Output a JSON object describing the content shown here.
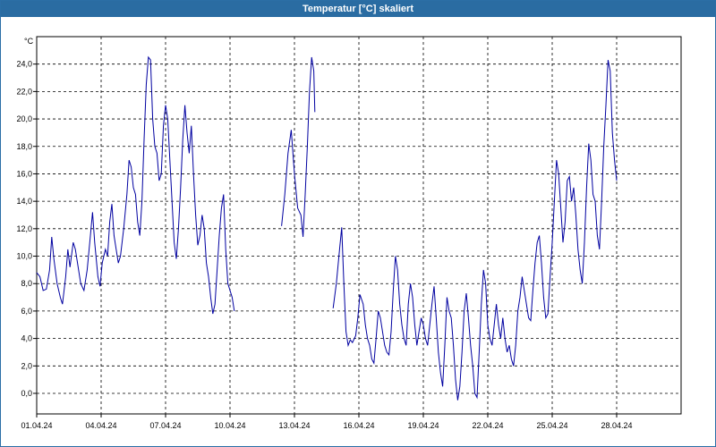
{
  "window": {
    "title": "Temperatur [°C] skaliert"
  },
  "chart_data": {
    "type": "line",
    "title": "Temperatur [°C] skaliert",
    "ylabel": "°C",
    "xlabel": "",
    "ylim": [
      -1.5,
      26.0
    ],
    "xlim": [
      0,
      30
    ],
    "grid": true,
    "y_ticks": [
      "0,0",
      "2,0",
      "4,0",
      "6,0",
      "8,0",
      "10,0",
      "12,0",
      "14,0",
      "16,0",
      "18,0",
      "20,0",
      "22,0",
      "24,0"
    ],
    "y_tick_values": [
      0,
      2,
      4,
      6,
      8,
      10,
      12,
      14,
      16,
      18,
      20,
      22,
      24
    ],
    "x_ticks": [
      "01.04.24",
      "04.04.24",
      "07.04.24",
      "10.04.24",
      "13.04.24",
      "16.04.24",
      "19.04.24",
      "22.04.24",
      "25.04.24",
      "28.04.24"
    ],
    "x_tick_values": [
      0,
      3,
      6,
      9,
      12,
      15,
      18,
      21,
      24,
      27
    ],
    "colors": {
      "line": "#0000a0",
      "grid": "#000000",
      "titlebar": "#2a6ca2"
    },
    "series": [
      {
        "segments": [
          [
            [
              0.0,
              8.8
            ],
            [
              0.15,
              8.5
            ],
            [
              0.3,
              7.5
            ],
            [
              0.45,
              7.6
            ],
            [
              0.6,
              9.0
            ],
            [
              0.7,
              11.4
            ],
            [
              0.8,
              9.8
            ],
            [
              0.95,
              8.0
            ],
            [
              1.1,
              7.0
            ],
            [
              1.2,
              6.5
            ],
            [
              1.35,
              8.5
            ],
            [
              1.45,
              10.5
            ],
            [
              1.55,
              9.2
            ],
            [
              1.7,
              11.0
            ],
            [
              1.8,
              10.5
            ],
            [
              1.9,
              9.5
            ],
            [
              2.05,
              8.0
            ],
            [
              2.2,
              7.5
            ],
            [
              2.35,
              9.0
            ],
            [
              2.5,
              11.5
            ],
            [
              2.6,
              13.2
            ],
            [
              2.7,
              11.0
            ],
            [
              2.85,
              8.5
            ],
            [
              2.95,
              7.8
            ],
            [
              3.05,
              9.5
            ],
            [
              3.2,
              10.5
            ],
            [
              3.3,
              10.0
            ],
            [
              3.4,
              12.5
            ],
            [
              3.5,
              13.8
            ],
            [
              3.6,
              11.5
            ],
            [
              3.7,
              10.5
            ],
            [
              3.8,
              9.5
            ],
            [
              3.9,
              10.0
            ],
            [
              4.05,
              12.0
            ],
            [
              4.2,
              14.5
            ],
            [
              4.3,
              17.0
            ],
            [
              4.4,
              16.5
            ],
            [
              4.5,
              15.0
            ],
            [
              4.6,
              14.5
            ],
            [
              4.7,
              12.5
            ],
            [
              4.8,
              11.5
            ],
            [
              4.9,
              14.0
            ],
            [
              5.0,
              18.5
            ],
            [
              5.1,
              22.5
            ],
            [
              5.2,
              24.5
            ],
            [
              5.3,
              24.3
            ],
            [
              5.4,
              20.0
            ],
            [
              5.5,
              18.0
            ],
            [
              5.6,
              17.5
            ],
            [
              5.7,
              15.5
            ],
            [
              5.8,
              16.0
            ],
            [
              5.9,
              19.5
            ],
            [
              6.0,
              21.0
            ],
            [
              6.1,
              20.0
            ],
            [
              6.2,
              17.0
            ],
            [
              6.3,
              14.0
            ],
            [
              6.4,
              11.0
            ],
            [
              6.5,
              9.8
            ],
            [
              6.6,
              12.0
            ],
            [
              6.7,
              15.0
            ],
            [
              6.8,
              18.5
            ],
            [
              6.9,
              21.0
            ],
            [
              7.0,
              19.0
            ],
            [
              7.1,
              17.5
            ],
            [
              7.2,
              19.5
            ],
            [
              7.3,
              16.0
            ],
            [
              7.4,
              13.0
            ],
            [
              7.5,
              10.8
            ],
            [
              7.6,
              11.5
            ],
            [
              7.7,
              13.0
            ],
            [
              7.8,
              12.0
            ],
            [
              7.9,
              9.5
            ],
            [
              8.0,
              8.5
            ],
            [
              8.1,
              7.0
            ],
            [
              8.2,
              5.8
            ],
            [
              8.3,
              6.5
            ],
            [
              8.4,
              9.0
            ],
            [
              8.5,
              11.5
            ],
            [
              8.6,
              13.5
            ],
            [
              8.7,
              14.5
            ],
            [
              8.8,
              10.5
            ],
            [
              8.9,
              8.0
            ],
            [
              9.0,
              7.5
            ],
            [
              9.1,
              7.0
            ],
            [
              9.2,
              6.0
            ]
          ],
          [
            [
              11.4,
              12.2
            ],
            [
              11.55,
              14.5
            ],
            [
              11.7,
              17.5
            ],
            [
              11.85,
              19.2
            ],
            [
              12.0,
              16.0
            ],
            [
              12.15,
              13.5
            ],
            [
              12.3,
              13.0
            ],
            [
              12.4,
              11.4
            ],
            [
              12.5,
              14.5
            ],
            [
              12.6,
              18.0
            ],
            [
              12.7,
              22.0
            ],
            [
              12.8,
              24.5
            ],
            [
              12.9,
              23.5
            ],
            [
              12.95,
              20.5
            ]
          ],
          [
            [
              13.8,
              6.2
            ],
            [
              13.95,
              8.0
            ],
            [
              14.1,
              10.5
            ],
            [
              14.2,
              12.1
            ],
            [
              14.3,
              8.0
            ],
            [
              14.4,
              4.5
            ],
            [
              14.5,
              3.5
            ],
            [
              14.6,
              3.9
            ],
            [
              14.7,
              3.7
            ],
            [
              14.85,
              4.2
            ],
            [
              14.95,
              5.5
            ],
            [
              15.05,
              7.2
            ],
            [
              15.2,
              6.5
            ],
            [
              15.3,
              5.0
            ],
            [
              15.4,
              4.0
            ],
            [
              15.5,
              3.5
            ],
            [
              15.6,
              2.5
            ],
            [
              15.7,
              2.2
            ],
            [
              15.8,
              4.0
            ],
            [
              15.9,
              6.0
            ],
            [
              16.0,
              5.5
            ],
            [
              16.1,
              4.5
            ],
            [
              16.2,
              3.5
            ],
            [
              16.3,
              3.0
            ],
            [
              16.4,
              2.8
            ],
            [
              16.5,
              4.5
            ],
            [
              16.6,
              7.5
            ],
            [
              16.7,
              10.0
            ],
            [
              16.8,
              9.0
            ],
            [
              16.9,
              6.5
            ],
            [
              17.0,
              5.0
            ],
            [
              17.1,
              4.0
            ],
            [
              17.2,
              3.5
            ],
            [
              17.3,
              6.5
            ],
            [
              17.4,
              8.0
            ],
            [
              17.5,
              7.0
            ],
            [
              17.6,
              5.0
            ],
            [
              17.7,
              3.5
            ],
            [
              17.8,
              4.5
            ],
            [
              17.9,
              5.5
            ],
            [
              18.0,
              5.0
            ],
            [
              18.1,
              4.0
            ],
            [
              18.2,
              3.5
            ],
            [
              18.3,
              5.0
            ],
            [
              18.4,
              6.5
            ],
            [
              18.5,
              7.8
            ],
            [
              18.6,
              5.5
            ],
            [
              18.7,
              3.0
            ],
            [
              18.8,
              1.5
            ],
            [
              18.9,
              0.5
            ],
            [
              19.0,
              3.5
            ],
            [
              19.1,
              7.0
            ],
            [
              19.2,
              6.0
            ],
            [
              19.3,
              5.5
            ],
            [
              19.4,
              3.5
            ],
            [
              19.5,
              1.0
            ],
            [
              19.6,
              -0.5
            ],
            [
              19.7,
              0.5
            ],
            [
              19.8,
              3.0
            ],
            [
              19.9,
              6.0
            ],
            [
              20.0,
              7.3
            ],
            [
              20.1,
              5.5
            ],
            [
              20.2,
              3.5
            ],
            [
              20.3,
              2.0
            ],
            [
              20.4,
              0.0
            ],
            [
              20.5,
              -0.3
            ],
            [
              20.6,
              3.0
            ],
            [
              20.7,
              6.5
            ],
            [
              20.8,
              9.0
            ],
            [
              20.9,
              8.0
            ],
            [
              21.0,
              5.0
            ],
            [
              21.1,
              4.0
            ],
            [
              21.2,
              3.5
            ],
            [
              21.3,
              5.0
            ],
            [
              21.4,
              6.5
            ],
            [
              21.5,
              5.0
            ],
            [
              21.6,
              4.0
            ],
            [
              21.7,
              5.5
            ],
            [
              21.8,
              4.0
            ],
            [
              21.9,
              3.0
            ],
            [
              22.0,
              3.5
            ],
            [
              22.1,
              2.5
            ],
            [
              22.2,
              2.0
            ],
            [
              22.3,
              3.5
            ],
            [
              22.4,
              6.0
            ],
            [
              22.5,
              7.0
            ],
            [
              22.6,
              8.5
            ],
            [
              22.7,
              7.5
            ],
            [
              22.8,
              6.5
            ],
            [
              22.9,
              5.5
            ],
            [
              23.0,
              5.3
            ],
            [
              23.1,
              7.5
            ],
            [
              23.2,
              9.5
            ],
            [
              23.3,
              11.0
            ],
            [
              23.4,
              11.5
            ],
            [
              23.5,
              9.5
            ],
            [
              23.6,
              7.0
            ],
            [
              23.7,
              5.5
            ],
            [
              23.8,
              5.8
            ],
            [
              23.9,
              8.5
            ],
            [
              24.0,
              11.0
            ],
            [
              24.1,
              14.0
            ],
            [
              24.2,
              17.0
            ],
            [
              24.3,
              16.0
            ],
            [
              24.4,
              13.5
            ],
            [
              24.5,
              11.0
            ],
            [
              24.6,
              12.5
            ],
            [
              24.7,
              15.5
            ],
            [
              24.8,
              15.8
            ],
            [
              24.9,
              14.0
            ],
            [
              25.0,
              15.0
            ],
            [
              25.1,
              13.0
            ],
            [
              25.2,
              10.5
            ],
            [
              25.3,
              9.0
            ],
            [
              25.4,
              8.0
            ],
            [
              25.5,
              11.0
            ],
            [
              25.6,
              15.0
            ],
            [
              25.7,
              18.2
            ],
            [
              25.8,
              17.0
            ],
            [
              25.9,
              14.5
            ],
            [
              26.0,
              14.0
            ],
            [
              26.1,
              11.5
            ],
            [
              26.2,
              10.5
            ],
            [
              26.3,
              14.0
            ],
            [
              26.4,
              18.0
            ],
            [
              26.5,
              21.0
            ],
            [
              26.6,
              24.3
            ],
            [
              26.7,
              23.5
            ],
            [
              26.8,
              19.0
            ],
            [
              26.9,
              17.0
            ],
            [
              27.0,
              15.5
            ]
          ]
        ]
      }
    ]
  }
}
